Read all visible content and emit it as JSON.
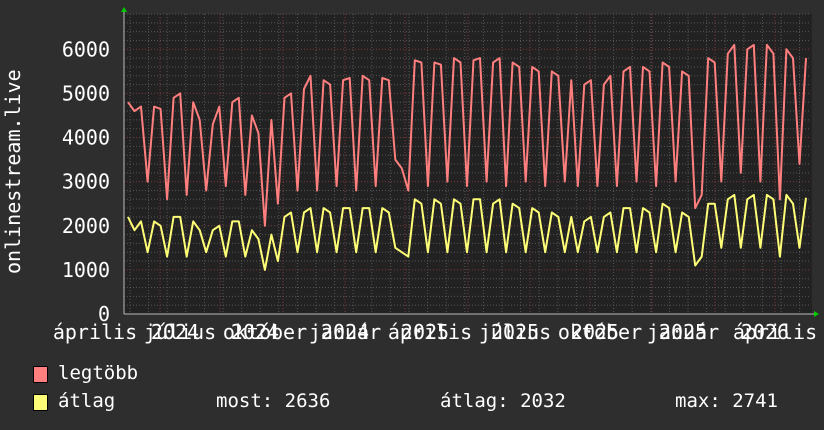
{
  "chart_data": {
    "type": "line",
    "ylabel": "onlinestream.live",
    "ylim": [
      0,
      6800
    ],
    "yticks": [
      "0",
      "1000",
      "2000",
      "3000",
      "4000",
      "5000",
      "6000"
    ],
    "xtick_months": [
      "április",
      "július",
      "október",
      "január",
      "április",
      "július",
      "október",
      "január",
      "április"
    ],
    "xtick_years": [
      "2024",
      "2024",
      "2024",
      "2025",
      "2025",
      "2025",
      "2025",
      "2026"
    ],
    "grid": true,
    "series": [
      {
        "name": "legtöbb",
        "color": "#ff7f7f",
        "values": [
          4800,
          4600,
          4700,
          3000,
          4700,
          4650,
          2600,
          4900,
          5000,
          2700,
          4800,
          4400,
          2800,
          4300,
          4700,
          2900,
          4800,
          4900,
          2700,
          4500,
          4100,
          2000,
          4400,
          2500,
          4900,
          5000,
          2800,
          5100,
          5400,
          2800,
          5300,
          5200,
          2900,
          5300,
          5350,
          2800,
          5400,
          5300,
          2900,
          5350,
          5300,
          3500,
          3300,
          2800,
          5750,
          5700,
          2900,
          5700,
          5650,
          3000,
          5800,
          5700,
          2900,
          5750,
          5800,
          3000,
          5700,
          5800,
          2900,
          5700,
          5600,
          3000,
          5600,
          5500,
          2900,
          5500,
          5400,
          3000,
          5300,
          2900,
          5200,
          5300,
          2900,
          5200,
          5400,
          2900,
          5500,
          5600,
          3000,
          5600,
          5500,
          2900,
          5700,
          5600,
          3000,
          5500,
          5400,
          2400,
          2700,
          5800,
          5700,
          3000,
          5900,
          6100,
          3200,
          6000,
          6100,
          3000,
          6100,
          5900,
          2600,
          6000,
          5800,
          3400,
          5800
        ]
      },
      {
        "name": "átlag",
        "color": "#ffff77",
        "values": [
          2200,
          1900,
          2100,
          1400,
          2100,
          2000,
          1300,
          2200,
          2200,
          1300,
          2100,
          1900,
          1400,
          1900,
          2000,
          1300,
          2100,
          2100,
          1300,
          1900,
          1700,
          1000,
          1800,
          1200,
          2200,
          2300,
          1400,
          2300,
          2400,
          1400,
          2400,
          2300,
          1400,
          2400,
          2400,
          1400,
          2400,
          2400,
          1400,
          2400,
          2300,
          1500,
          1400,
          1300,
          2600,
          2500,
          1400,
          2600,
          2500,
          1400,
          2600,
          2500,
          1400,
          2600,
          2600,
          1400,
          2500,
          2600,
          1400,
          2500,
          2400,
          1400,
          2400,
          2300,
          1400,
          2300,
          2200,
          1400,
          2200,
          1400,
          2100,
          2200,
          1400,
          2200,
          2300,
          1400,
          2400,
          2400,
          1400,
          2400,
          2300,
          1400,
          2500,
          2400,
          1400,
          2300,
          2200,
          1100,
          1300,
          2500,
          2500,
          1500,
          2600,
          2700,
          1500,
          2600,
          2700,
          1500,
          2700,
          2600,
          1300,
          2700,
          2500,
          1500,
          2636
        ]
      }
    ]
  },
  "legend": {
    "items": [
      {
        "label": "legtöbb",
        "color": "#ff7f7f"
      },
      {
        "label": "átlag",
        "color": "#ffff77"
      }
    ],
    "stats": {
      "most": "most: 2636",
      "atlag": "átlag: 2032",
      "max": "max: 2741"
    }
  }
}
